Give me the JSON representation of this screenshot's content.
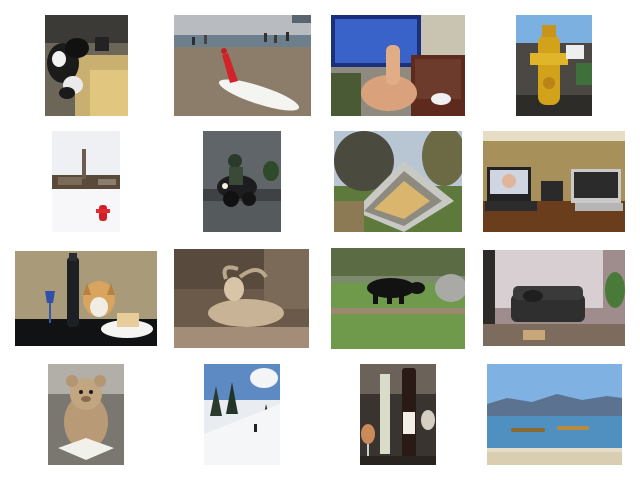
{
  "gallery": {
    "rows": 4,
    "columns": 4,
    "images": [
      {
        "subject": "cows-in-barn-thumbnail"
      },
      {
        "subject": "beach-surfboard-thumbnail"
      },
      {
        "subject": "thumbs-up-monitor-thumbnail"
      },
      {
        "subject": "yellow-hydrant-thumbnail"
      },
      {
        "subject": "snow-hydrant-thumbnail"
      },
      {
        "subject": "motorcycle-rider-thumbnail"
      },
      {
        "subject": "tilted-house-sculpture-thumbnail"
      },
      {
        "subject": "office-laptops-thumbnail"
      },
      {
        "subject": "dog-wine-cake-thumbnail"
      },
      {
        "subject": "mountain-goat-thumbnail"
      },
      {
        "subject": "black-bear-thumbnail"
      },
      {
        "subject": "couch-living-room-thumbnail"
      },
      {
        "subject": "teddy-bear-book-thumbnail"
      },
      {
        "subject": "snowy-slope-trees-thumbnail"
      },
      {
        "subject": "wine-bottles-thumbnail"
      },
      {
        "subject": "boats-on-lake-thumbnail"
      }
    ]
  }
}
